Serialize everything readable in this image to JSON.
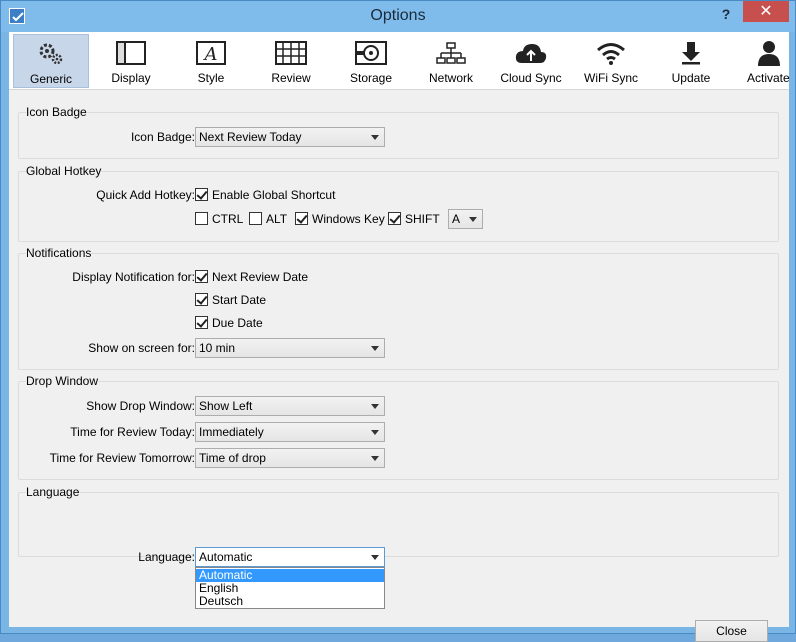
{
  "window": {
    "title": "Options",
    "help_label": "?",
    "close_label": "✕"
  },
  "toolbar": {
    "items": [
      {
        "label": "Generic",
        "icon": "gears-icon",
        "active": true
      },
      {
        "label": "Display",
        "icon": "display-icon"
      },
      {
        "label": "Style",
        "icon": "style-icon"
      },
      {
        "label": "Review",
        "icon": "review-icon"
      },
      {
        "label": "Storage",
        "icon": "storage-icon"
      },
      {
        "label": "Network",
        "icon": "network-icon"
      },
      {
        "label": "Cloud Sync",
        "icon": "cloud-sync-icon"
      },
      {
        "label": "WiFi Sync",
        "icon": "wifi-icon"
      },
      {
        "label": "Update",
        "icon": "download-arrow-icon"
      },
      {
        "label": "Activate",
        "icon": "person-icon"
      }
    ]
  },
  "icon_badge": {
    "title": "Icon Badge",
    "label": "Icon Badge:",
    "value": "Next Review Today"
  },
  "global_hotkey": {
    "title": "Global Hotkey",
    "label": "Quick Add Hotkey:",
    "enable_label": "Enable Global Shortcut",
    "enable_checked": true,
    "ctrl_label": "CTRL",
    "ctrl_checked": false,
    "alt_label": "ALT",
    "alt_checked": false,
    "winkey_label": "Windows Key",
    "winkey_checked": true,
    "shift_label": "SHIFT",
    "shift_checked": true,
    "key_value": "A"
  },
  "notifications": {
    "title": "Notifications",
    "label": "Display Notification for:",
    "next_review_label": "Next Review Date",
    "start_date_label": "Start Date",
    "due_date_label": "Due Date",
    "show_label": "Show on screen for:",
    "show_value": "10 min"
  },
  "drop_window": {
    "title": "Drop Window",
    "show_label": "Show Drop Window:",
    "show_value": "Show Left",
    "today_label": "Time for Review Today:",
    "today_value": "Immediately",
    "tomorrow_label": "Time for Review Tomorrow:",
    "tomorrow_value": "Time of drop"
  },
  "language": {
    "title": "Language",
    "label": "Language:",
    "value": "Automatic",
    "options": [
      "Automatic",
      "English",
      "Deutsch"
    ]
  },
  "footer": {
    "close_label": "Close"
  },
  "colors": {
    "titlebar": "#7fbcec",
    "close_window": "#c7504f",
    "selection": "#3399ff"
  }
}
